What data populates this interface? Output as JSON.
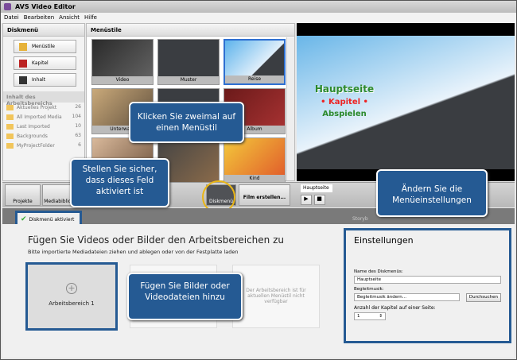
{
  "window": {
    "title": "AVS Video Editor"
  },
  "menu": [
    "Datei",
    "Bearbeiten",
    "Ansicht",
    "Hilfe"
  ],
  "left": {
    "header": "Diskmenü",
    "buttons": [
      "Menüstile",
      "Kapitel",
      "Inhalt"
    ],
    "section": "Inhalt des Arbeitsbereichs",
    "folders": [
      {
        "name": "Aktuelles Projekt",
        "count": "26"
      },
      {
        "name": "All Imported Media",
        "count": "104"
      },
      {
        "name": "Last Imported",
        "count": "10"
      },
      {
        "name": "Backgrounds",
        "count": "63"
      },
      {
        "name": "MyProjectFolder",
        "count": "6"
      }
    ]
  },
  "styles": {
    "header": "Menüstile",
    "tiles": [
      "Video",
      "Muster",
      "Reise",
      "Unterwass",
      "",
      "Album",
      "",
      "",
      "Kind"
    ]
  },
  "preview": {
    "title": "Hauptseite",
    "chapters": "• Kapitel •",
    "play": "Abspielen"
  },
  "toolbar": {
    "projects": "Projekte",
    "library": "Mediabiblioth",
    "menu": "Diskmenü",
    "create": "Film erstellen..."
  },
  "player": {
    "tab": "Hauptseite",
    "play": "▶",
    "stop": "■"
  },
  "storyboard": "Storyb",
  "checkbox": "Diskmenü aktiviert",
  "work": {
    "title": "Fügen Sie Videos oder Bilder den Arbeitsbereichen zu",
    "subtitle": "Bitte importierte Mediadateien ziehen und ablegen oder von der Festplatte laden",
    "area1": "Arbeitsbereich 1",
    "unavailable": "Der Arbeitsbereich ist für aktuellen Menüstil nicht verfügbar"
  },
  "settings": {
    "title": "Einstellungen",
    "name_label": "Name des Diskmenüs:",
    "name_value": "Hauptseite",
    "music_label": "Begleitmusik:",
    "music_value": "Begleitmusik ändern...",
    "browse": "Durchsuchen",
    "chapters_label": "Anzahl der Kapitel auf einer Seite:",
    "chapters_value": "1"
  },
  "callouts": {
    "style": "Klicken Sie zweimal auf einen Menüstil",
    "check": "Stellen Sie sicher, dass dieses Feld aktiviert ist",
    "settings": "Ändern Sie die Menüeinstellungen",
    "add": "Fügen Sie Bilder oder Videodateien hinzu"
  }
}
